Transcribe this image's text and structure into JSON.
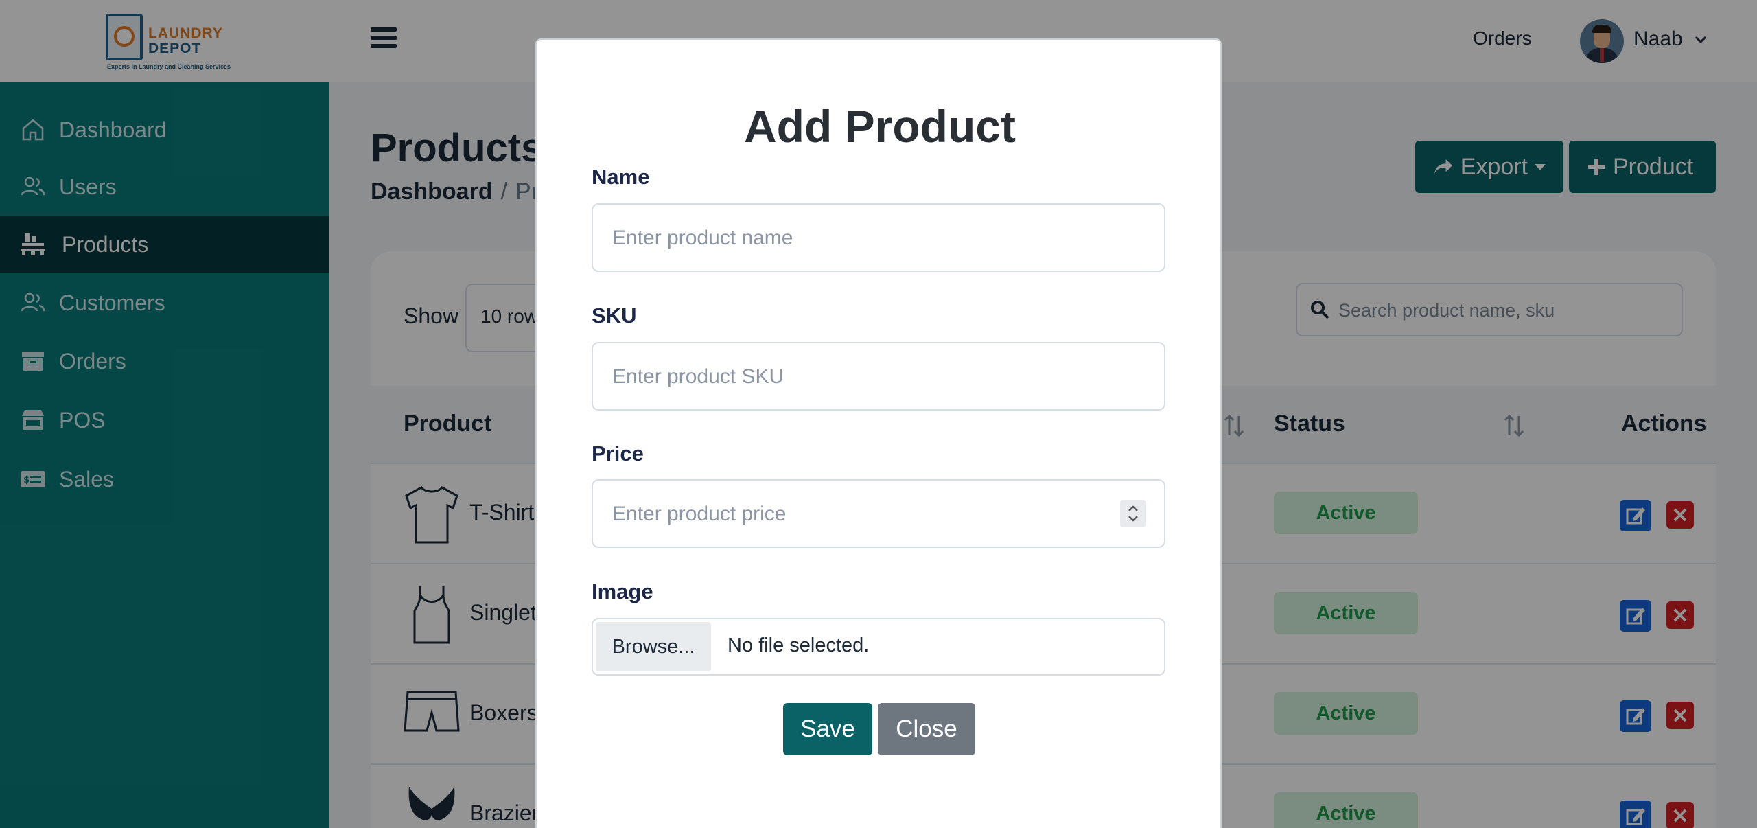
{
  "brand": {
    "name_line1": "LAUNDRY",
    "name_line2": "DEPOT",
    "tagline": "Experts in Laundry and Cleaning Services"
  },
  "header": {
    "orders_link": "Orders",
    "user_name": "Naab"
  },
  "sidebar": {
    "items": [
      {
        "label": "Dashboard",
        "icon": "home-icon",
        "active": false
      },
      {
        "label": "Users",
        "icon": "users-icon",
        "active": false
      },
      {
        "label": "Products",
        "icon": "pallet-icon",
        "active": true
      },
      {
        "label": "Customers",
        "icon": "users-icon",
        "active": false
      },
      {
        "label": "Orders",
        "icon": "archive-icon",
        "active": false
      },
      {
        "label": "POS",
        "icon": "store-icon",
        "active": false
      },
      {
        "label": "Sales",
        "icon": "money-card-icon",
        "active": false
      }
    ]
  },
  "page": {
    "title": "Products",
    "breadcrumb": {
      "home": "Dashboard",
      "separator": "/",
      "current": "Products"
    },
    "export_label": "Export",
    "add_product_label": "Product"
  },
  "table": {
    "show_label": "Show",
    "rows_select_value": "10 rows",
    "search_placeholder": "Search product name, sku",
    "columns": {
      "product": "Product",
      "status": "Status",
      "actions": "Actions"
    },
    "rows": [
      {
        "name": "T-Shirt",
        "image": "tshirt-icon",
        "status": "Active"
      },
      {
        "name": "Singlet",
        "image": "singlet-icon",
        "status": "Active"
      },
      {
        "name": "Boxers",
        "image": "boxers-icon",
        "status": "Active"
      },
      {
        "name": "Brazier",
        "image": "bra-icon",
        "status": "Active"
      }
    ]
  },
  "modal": {
    "title": "Add Product",
    "name_label": "Name",
    "name_placeholder": "Enter product name",
    "sku_label": "SKU",
    "sku_placeholder": "Enter product SKU",
    "price_label": "Price",
    "price_placeholder": "Enter product price",
    "image_label": "Image",
    "browse_label": "Browse...",
    "file_status": "No file selected.",
    "save_label": "Save",
    "close_label": "Close"
  },
  "colors": {
    "sidebar": "#0a7a7b",
    "sidebar_active": "#06393e",
    "primary_button": "#0a6266",
    "close_button": "#6e7780",
    "status_active_bg": "#d4f1de",
    "status_active_text": "#1f9a4a",
    "edit_button": "#1565d8",
    "delete_button": "#d21f26"
  }
}
